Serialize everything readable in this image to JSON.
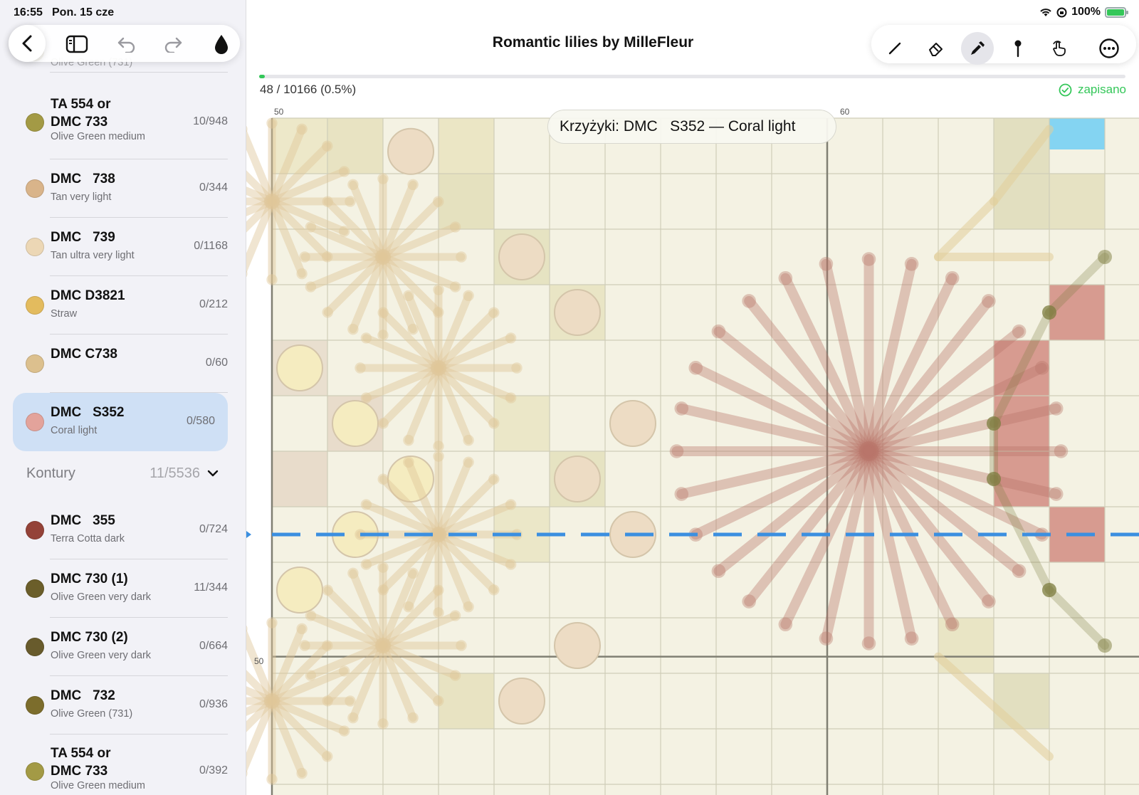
{
  "status_bar": {
    "time": "16:55",
    "date": "Pon. 15 cze",
    "battery": "100%"
  },
  "sidebar": {
    "partial_top_row": {
      "sub": "Olive Green (731)"
    },
    "colors_top": [
      {
        "name": "TA 554 or\nDMC 733",
        "desc": "Olive Green medium",
        "count": "10/948",
        "color": "#a39a45"
      },
      {
        "name": "DMC   738",
        "desc": "Tan very light",
        "count": "0/344",
        "color": "#d9b48a"
      },
      {
        "name": "DMC   739",
        "desc": "Tan ultra very light",
        "count": "0/1168",
        "color": "#ecd7b5"
      },
      {
        "name": "DMC D3821",
        "desc": "Straw",
        "count": "0/212",
        "color": "#e3bb5e"
      },
      {
        "name": "DMC C738",
        "desc": "",
        "count": "0/60",
        "color": "#dcc08e"
      },
      {
        "name": "DMC   S352",
        "desc": "Coral light",
        "count": "0/580",
        "color": "#e3a39b",
        "selected": true
      }
    ],
    "section": {
      "title": "Kontury",
      "count": "11/5536"
    },
    "colors_bottom": [
      {
        "name": "DMC   355",
        "desc": "Terra Cotta dark",
        "count": "0/724",
        "color": "#944238"
      },
      {
        "name": "DMC 730 (1)",
        "desc": "Olive Green very dark",
        "count": "11/344",
        "color": "#6b5e2a"
      },
      {
        "name": "DMC 730 (2)",
        "desc": "Olive Green very dark",
        "count": "0/664",
        "color": "#685b2c"
      },
      {
        "name": "DMC   732",
        "desc": "Olive Green (731)",
        "count": "0/936",
        "color": "#7c6d2c"
      },
      {
        "name": "TA 554 or\nDMC 733",
        "desc": "Olive Green medium",
        "count": "0/392",
        "color": "#a39a45"
      }
    ]
  },
  "header": {
    "title": "Romantic lilies by MilleFleur"
  },
  "progress": {
    "text": "48 / 10166 (0.5%)",
    "fraction": 0.0047,
    "saved_label": "zapisano"
  },
  "tooltip": "Krzyżyki: DMC   S352 — Coral light",
  "grid": {
    "col_label_a": "50",
    "col_label_b": "60",
    "row_label": "50"
  },
  "toolbar": {
    "tools": [
      "pencil-icon",
      "eraser-icon",
      "eyedropper-icon",
      "pin-icon",
      "hand-pointer-icon",
      "more-icon"
    ],
    "active_tool": "eyedropper-icon"
  },
  "colors": {
    "accent": "#007aff",
    "saved": "#34c759",
    "selection": "#cfe0f5",
    "guide": "#3b8fe0"
  }
}
